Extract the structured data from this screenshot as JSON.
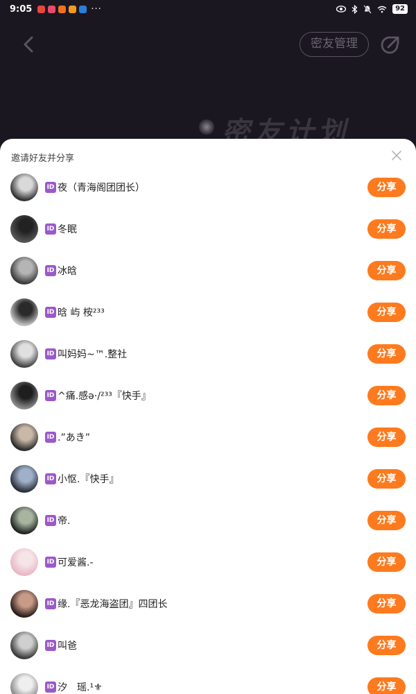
{
  "status_bar": {
    "time": "9:05",
    "dots": "···",
    "battery": "92",
    "app_icon_colors": [
      "#e8473f",
      "#e84c6c",
      "#f07020",
      "#f29a1f",
      "#2a7fd8"
    ]
  },
  "header": {
    "manage_label": "密友管理",
    "banner_text": "密友计划"
  },
  "sheet": {
    "title": "邀请好友并分享",
    "share_label": "分享",
    "badge_label": "ID",
    "friends": [
      {
        "name": "夜（青海阁团团长）",
        "avatar_colors": [
          "#d9d9d9",
          "#333333"
        ]
      },
      {
        "name": "冬眠",
        "avatar_colors": [
          "#222222",
          "#555555"
        ]
      },
      {
        "name": "冰晗",
        "avatar_colors": [
          "#b5b5b5",
          "#3a3a3a"
        ]
      },
      {
        "name": "晗 屿 桉²³³",
        "avatar_colors": [
          "#2a2a2a",
          "#c0c0c0"
        ]
      },
      {
        "name": "叫妈妈~™.整社",
        "avatar_colors": [
          "#e0e0e0",
          "#444444"
        ]
      },
      {
        "name": "^痛.感ə·/²³³『快手』",
        "avatar_colors": [
          "#1e1e1e",
          "#8a8a8a"
        ]
      },
      {
        "name": ".”あき”",
        "avatar_colors": [
          "#c8b8a8",
          "#2c2c2c"
        ]
      },
      {
        "name": "小怄.『快手』",
        "avatar_colors": [
          "#9fb0c8",
          "#2a2e3a"
        ]
      },
      {
        "name": "帝.",
        "avatar_colors": [
          "#a8b4a0",
          "#1f2420"
        ]
      },
      {
        "name": "可爱酱.-",
        "avatar_colors": [
          "#f5e4e8",
          "#e8b8c4"
        ]
      },
      {
        "name": "缘.『恶龙海盗团』四团长",
        "avatar_colors": [
          "#c89a88",
          "#2a1e1a"
        ]
      },
      {
        "name": "叫爸",
        "avatar_colors": [
          "#cfcfcf",
          "#3a3a3a"
        ]
      },
      {
        "name": "汐　瑶.¹⚜",
        "avatar_colors": [
          "#efefef",
          "#888888"
        ]
      }
    ]
  }
}
